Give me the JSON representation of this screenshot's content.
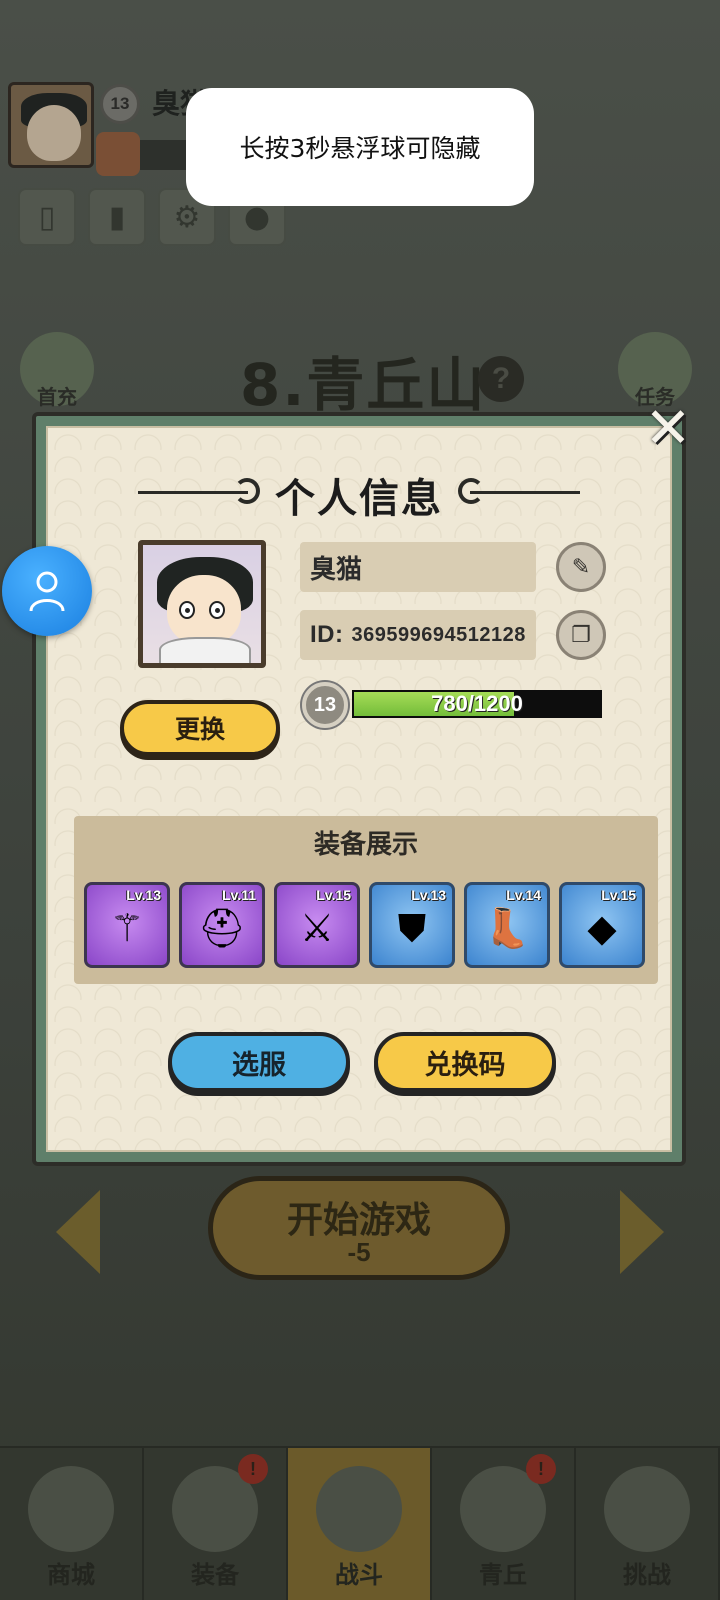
{
  "toast": {
    "message": "长按3秒悬浮球可隐藏"
  },
  "background": {
    "player_name": "臭猫",
    "player_level": "13",
    "level_title": "8.青丘山",
    "help_symbol": "?",
    "side_left_label": "首充",
    "side_right_label": "任务",
    "start_button": {
      "label": "开始游戏",
      "cost": "-5"
    },
    "bottom_nav": [
      {
        "label": "商城",
        "badge": ""
      },
      {
        "label": "装备",
        "badge": "!"
      },
      {
        "label": "战斗",
        "badge": ""
      },
      {
        "label": "青丘",
        "badge": "!"
      },
      {
        "label": "挑战",
        "badge": ""
      }
    ],
    "tool_icons": [
      "card-icon",
      "chart-icon",
      "settings-icon",
      "friends-icon"
    ]
  },
  "modal": {
    "title": "个人信息",
    "close_symbol": "✕",
    "change_avatar_label": "更换",
    "name": "臭猫",
    "id_label": "ID:",
    "id_value": "369599694512128",
    "level": "13",
    "xp_text": "780/1200",
    "xp_progress": 0.65,
    "equipment": {
      "title": "装备展示",
      "items": [
        {
          "level": "Lv.13",
          "rarity": "purple",
          "icon": "staff-icon"
        },
        {
          "level": "Lv.11",
          "rarity": "purple",
          "icon": "helmet-icon"
        },
        {
          "level": "Lv.15",
          "rarity": "purple",
          "icon": "armor-icon"
        },
        {
          "level": "Lv.13",
          "rarity": "blue",
          "icon": "shoulder-icon"
        },
        {
          "level": "Lv.14",
          "rarity": "blue",
          "icon": "boots-icon"
        },
        {
          "level": "Lv.15",
          "rarity": "blue",
          "icon": "amulet-icon"
        }
      ]
    },
    "select_server_label": "选服",
    "redeem_code_label": "兑换码"
  },
  "colors": {
    "accent_yellow": "#f7c948",
    "accent_blue": "#4fb0e3",
    "xp_green": "#8fd24a",
    "float_ball": "#2a8ff0"
  }
}
